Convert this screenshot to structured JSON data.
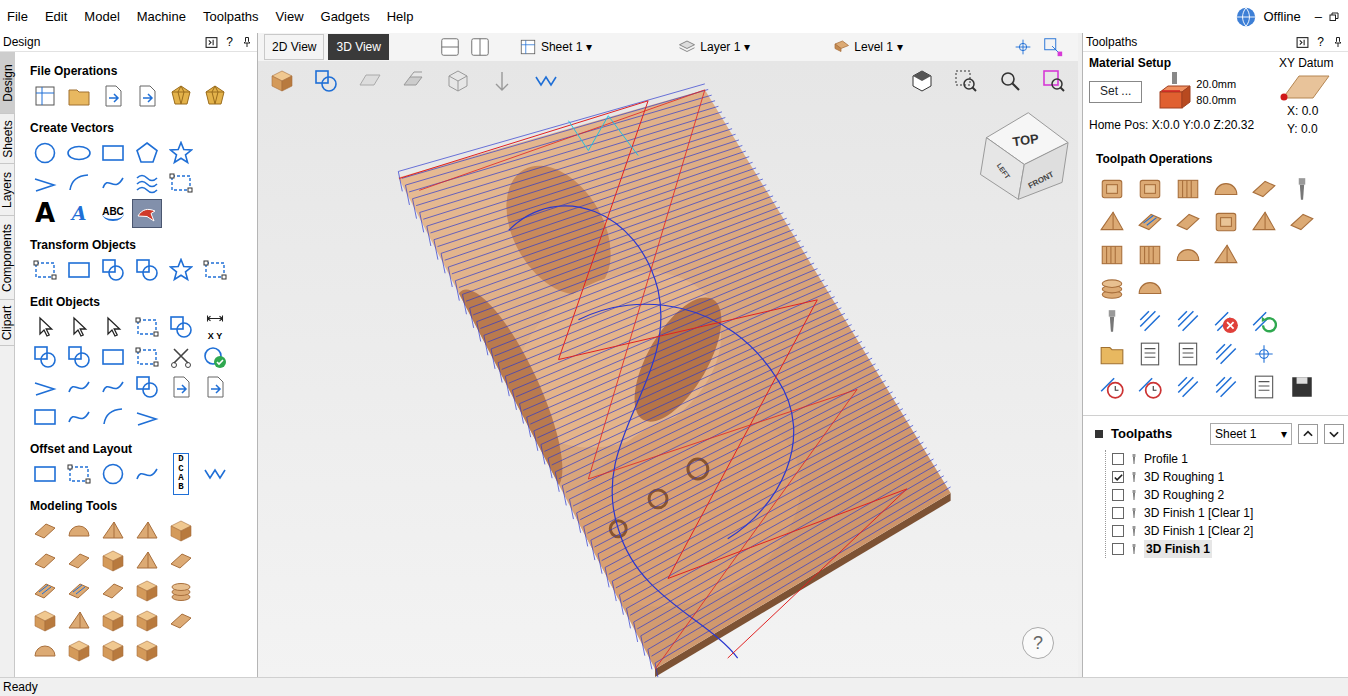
{
  "menu": [
    "File",
    "Edit",
    "Model",
    "Machine",
    "Toolpaths",
    "View",
    "Gadgets",
    "Help"
  ],
  "connection": {
    "label": "Offline"
  },
  "window": {
    "minimize": "–"
  },
  "design_panel": {
    "title": "Design",
    "help": "?",
    "tabs": [
      {
        "label": "Design",
        "selected": true
      },
      {
        "label": "Sheets",
        "selected": false
      },
      {
        "label": "Layers",
        "selected": false
      },
      {
        "label": "Components",
        "selected": false
      },
      {
        "label": "Clipart",
        "selected": false
      }
    ],
    "sections": [
      {
        "title": "File Operations",
        "tools": [
          {
            "selected": false
          },
          {
            "selected": false
          },
          {
            "selected": false
          },
          {
            "selected": false
          },
          {
            "selected": false
          },
          {
            "selected": false
          }
        ]
      },
      {
        "title": "Create Vectors",
        "tools": [
          {
            "selected": false
          },
          {
            "selected": false
          },
          {
            "selected": false
          },
          {
            "selected": false
          },
          {
            "selected": false
          },
          {
            "selected": false
          },
          {
            "selected": false
          },
          {
            "selected": false
          },
          {
            "selected": false
          },
          {
            "selected": false
          },
          {
            "text": "A",
            "selected": false
          },
          {
            "text": "A",
            "selected": false
          },
          {
            "text": "ABC",
            "selected": false
          },
          {
            "selected": true
          }
        ]
      },
      {
        "title": "Transform Objects",
        "tools": [
          {
            "selected": false
          },
          {
            "selected": false
          },
          {
            "selected": false
          },
          {
            "selected": false
          },
          {
            "selected": false
          },
          {
            "selected": false
          }
        ]
      },
      {
        "title": "Edit Objects",
        "tools": [
          {
            "selected": false
          },
          {
            "selected": false
          },
          {
            "selected": false
          },
          {
            "selected": false
          },
          {
            "selected": false
          },
          {
            "text": "X Y",
            "selected": false
          },
          {
            "selected": false
          },
          {
            "selected": false
          },
          {
            "selected": false
          },
          {
            "selected": false
          },
          {
            "selected": false
          },
          {
            "selected": false
          },
          {
            "selected": false
          },
          {
            "selected": false
          },
          {
            "selected": false
          },
          {
            "selected": false
          },
          {
            "selected": false
          },
          {
            "selected": false
          },
          {
            "selected": false
          },
          {
            "selected": false
          },
          {
            "selected": false
          },
          {
            "selected": false
          }
        ]
      },
      {
        "title": "Offset and Layout",
        "tools": [
          {
            "selected": false
          },
          {
            "selected": false
          },
          {
            "selected": false
          },
          {
            "selected": false
          },
          {
            "text": "DCAB",
            "selected": false
          },
          {
            "selected": false
          }
        ]
      },
      {
        "title": "Modeling Tools",
        "tools": [
          {
            "selected": false
          },
          {
            "selected": false
          },
          {
            "selected": false
          },
          {
            "selected": false
          },
          {
            "selected": false
          },
          {
            "selected": false
          },
          {
            "selected": false
          },
          {
            "selected": false
          },
          {
            "selected": false
          },
          {
            "selected": false
          },
          {
            "selected": false
          },
          {
            "selected": false
          },
          {
            "selected": false
          },
          {
            "selected": false
          },
          {
            "selected": false
          },
          {
            "selected": false
          },
          {
            "selected": false
          },
          {
            "selected": false
          },
          {
            "selected": false
          },
          {
            "selected": false
          },
          {
            "selected": false
          },
          {
            "selected": false
          },
          {
            "selected": false
          },
          {
            "selected": false
          }
        ]
      }
    ]
  },
  "view_toolbar": {
    "views": [
      {
        "label": "2D View",
        "selected": false
      },
      {
        "label": "3D View",
        "selected": true
      }
    ],
    "dropdowns": [
      {
        "label": "Sheet 1"
      },
      {
        "label": "Layer 1"
      },
      {
        "label": "Level 1"
      }
    ],
    "caret": "▾"
  },
  "viewport": {
    "cube": {
      "top": "TOP",
      "left": "LEFT",
      "front": "FRONT"
    },
    "help": "?"
  },
  "toolpaths_panel": {
    "title": "Toolpaths",
    "help": "?",
    "material": {
      "title": "Material Setup",
      "button": "Set ...",
      "thickness": "20.0mm",
      "depth": "80.0mm",
      "datum_label": "XY Datum",
      "home": "Home Pos: X:0.0 Y:0.0 Z:20.32",
      "x": "X: 0.0",
      "y": "Y: 0.0"
    },
    "operations_title": "Toolpath Operations",
    "list_title": "Toolpaths",
    "sheet": "Sheet 1",
    "items": [
      {
        "label": "Profile 1",
        "checked": false,
        "selected": false
      },
      {
        "label": "3D Roughing 1",
        "checked": true,
        "selected": false
      },
      {
        "label": "3D Roughing 2",
        "checked": false,
        "selected": false
      },
      {
        "label": "3D Finish 1 [Clear 1]",
        "checked": false,
        "selected": false
      },
      {
        "label": "3D Finish 1 [Clear 2]",
        "checked": false,
        "selected": false
      },
      {
        "label": "3D Finish 1",
        "checked": false,
        "selected": true
      }
    ]
  },
  "status_bar": {
    "text": "Ready"
  }
}
